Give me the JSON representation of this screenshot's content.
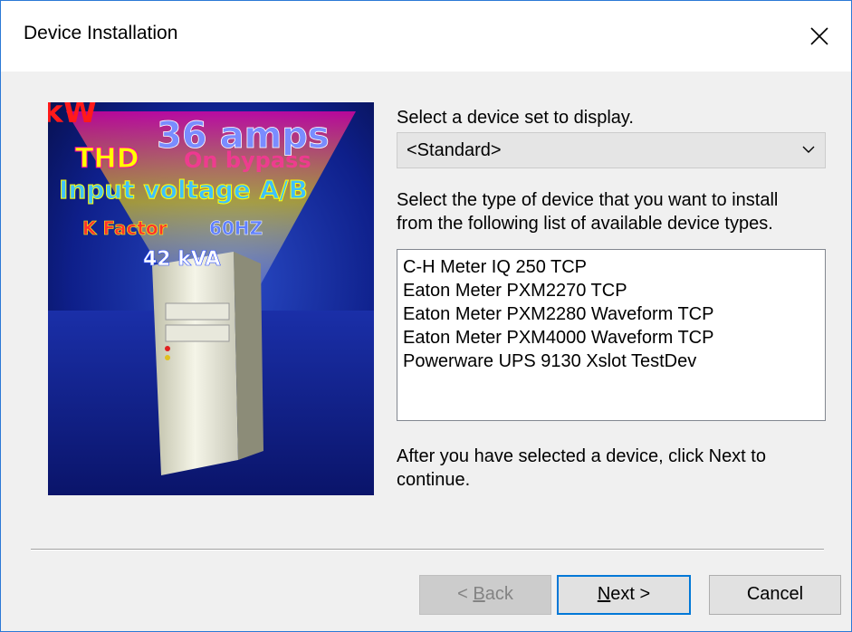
{
  "window": {
    "title": "Device Installation"
  },
  "banner": {
    "texts": [
      "kW",
      "36 amps",
      "THD",
      "On bypass",
      "Input voltage A/B",
      "K Factor",
      "60HZ",
      "42 kVA"
    ]
  },
  "device_set": {
    "prompt": "Select a device set to display.",
    "selected": "<Standard>"
  },
  "device_type": {
    "prompt_line1": "Select the type of device that you want to install",
    "prompt_line2": "from the following list of available device types.",
    "items": [
      "C-H Meter IQ 250 TCP",
      "Eaton Meter PXM2270 TCP",
      "Eaton Meter PXM2280 Waveform TCP",
      "Eaton Meter PXM4000 Waveform TCP",
      "Powerware UPS 9130 Xslot TestDev"
    ]
  },
  "hint": {
    "line1": "After you have selected a device, click Next to",
    "line2": "continue."
  },
  "buttons": {
    "back_prefix": "< ",
    "back_accel": "B",
    "back_rest": "ack",
    "next_accel": "N",
    "next_rest": "ext >",
    "cancel": "Cancel"
  }
}
